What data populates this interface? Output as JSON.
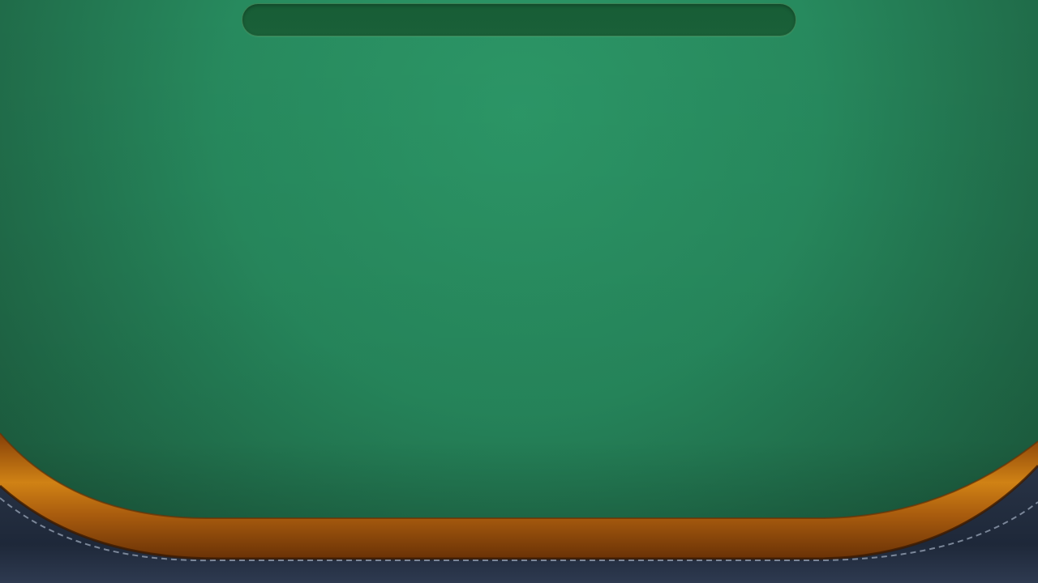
{
  "game": {
    "status_bar": {
      "message": ""
    }
  },
  "colors": {
    "felt_center": "#2c9767",
    "felt_edge": "#1d5a3d",
    "rail_wood_light": "#c77a14",
    "rail_wood_dark": "#7a3a08",
    "leather": "#1f2a3c",
    "stitching": "#9aa6b8",
    "status_bar_bg": "#175d36"
  }
}
